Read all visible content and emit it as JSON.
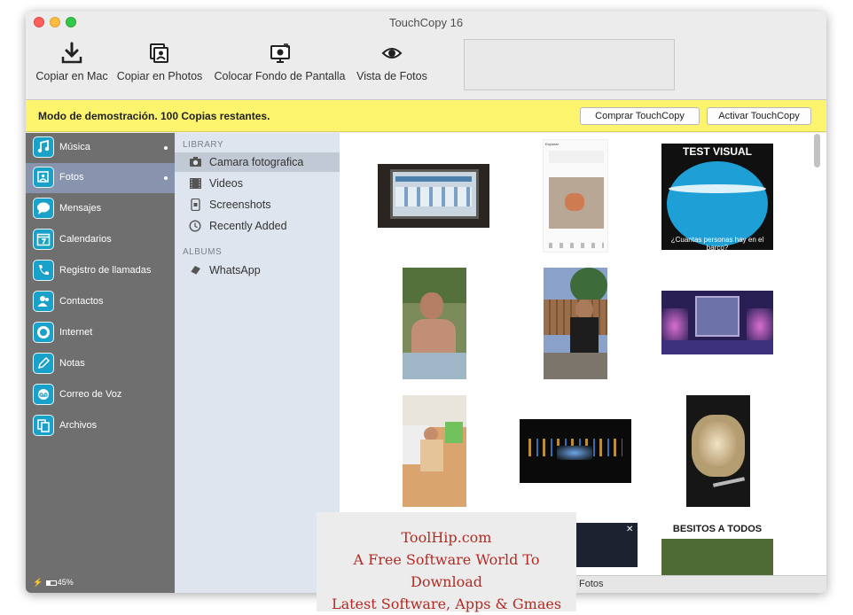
{
  "window": {
    "title": "TouchCopy 16"
  },
  "toolbar": [
    {
      "label": "Copiar en Mac",
      "icon": "download-icon"
    },
    {
      "label": "Copiar en Photos",
      "icon": "photos-icon"
    },
    {
      "label": "Colocar Fondo de Pantalla",
      "icon": "wallpaper-icon"
    },
    {
      "label": "Vista de Fotos",
      "icon": "eye-icon"
    }
  ],
  "banner": {
    "text": "Modo de demostración. 100 Copias restantes.",
    "buy_label": "Comprar TouchCopy",
    "activate_label": "Activar TouchCopy",
    "color": "#fdf46e"
  },
  "sidebar": {
    "items": [
      {
        "label": "Música",
        "icon": "music-icon",
        "dot": true
      },
      {
        "label": "Fotos",
        "icon": "photo-icon",
        "dot": true,
        "selected": true
      },
      {
        "label": "Mensajes",
        "icon": "message-icon"
      },
      {
        "label": "Calendarios",
        "icon": "calendar-icon"
      },
      {
        "label": "Registro de llamadas",
        "icon": "phone-icon"
      },
      {
        "label": "Contactos",
        "icon": "contacts-icon"
      },
      {
        "label": "Internet",
        "icon": "internet-icon"
      },
      {
        "label": "Notas",
        "icon": "pencil-icon"
      },
      {
        "label": "Correo de Voz",
        "icon": "voicemail-icon"
      },
      {
        "label": "Archivos",
        "icon": "files-icon"
      }
    ],
    "battery": "45%",
    "accent": "#1aa1c9"
  },
  "library": {
    "library_heading": "LIBRARY",
    "items": [
      {
        "label": "Camara fotografica",
        "icon": "camera-icon",
        "selected": true
      },
      {
        "label": "Videos",
        "icon": "film-icon"
      },
      {
        "label": "Screenshots",
        "icon": "phone-screen-icon"
      },
      {
        "label": "Recently Added",
        "icon": "clock-icon"
      }
    ],
    "albums_heading": "ALBUMS",
    "albums": [
      {
        "label": "WhatsApp",
        "icon": "album-icon"
      }
    ]
  },
  "gallery": {
    "images": [
      {
        "name": "photo-monitor-screen"
      },
      {
        "name": "photo-instagram-screenshot",
        "caption": "Explorar"
      },
      {
        "name": "photo-test-visual",
        "caption_top": "TEST VISUAL",
        "caption_bottom": "¿Cuantas personas hay en el barco?"
      },
      {
        "name": "photo-man-at-table"
      },
      {
        "name": "photo-man-in-garden"
      },
      {
        "name": "photo-stage-lights"
      },
      {
        "name": "photo-child-toys"
      },
      {
        "name": "photo-night-lights"
      },
      {
        "name": "photo-food-plate"
      },
      {
        "name": "photo-dark-screenshot"
      },
      {
        "name": "photo-besitos",
        "caption": "BESITOS A TODOS"
      }
    ],
    "footer_label": "Fotos"
  },
  "watermark": {
    "line1": "ToolHip.com",
    "line2": "A Free Software World To Download",
    "line3": "Latest Software, Apps & Gmaes"
  }
}
